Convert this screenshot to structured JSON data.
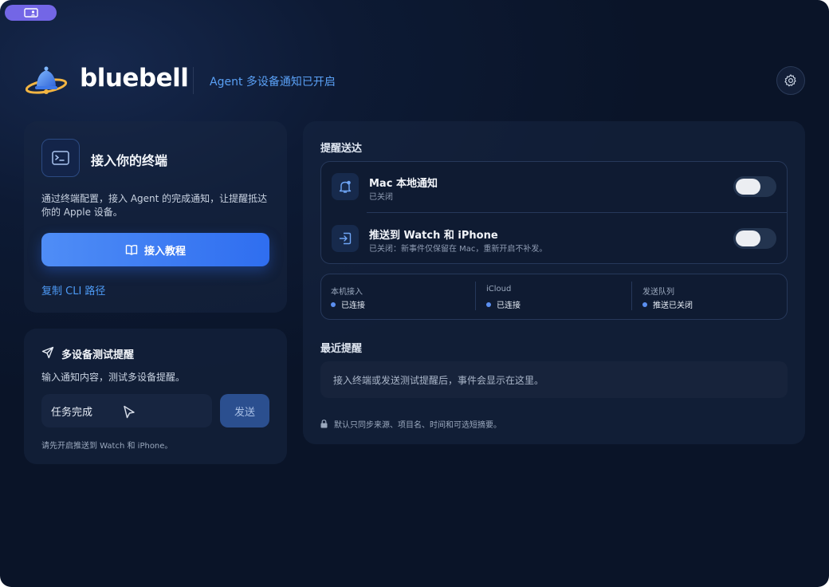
{
  "app": {
    "name": "bluebell",
    "status": "Agent 多设备通知已开启"
  },
  "terminal_card": {
    "title": "接入你的终端",
    "description": "通过终端配置，接入 Agent 的完成通知，让提醒抵达你的 Apple 设备。",
    "tutorial_button": "接入教程",
    "copy_cli": "复制 CLI 路径"
  },
  "test_card": {
    "title": "多设备测试提醒",
    "description": "输入通知内容，测试多设备提醒。",
    "input_value": "任务完成",
    "send_button": "发送",
    "hint": "请先开启推送到 Watch 和 iPhone。"
  },
  "delivery": {
    "section_title": "提醒送达",
    "rows": [
      {
        "title": "Mac 本地通知",
        "subtitle": "已关闭",
        "enabled": false
      },
      {
        "title": "推送到 Watch 和 iPhone",
        "subtitle": "已关闭：新事件仅保留在 Mac，重新开启不补发。",
        "enabled": false
      }
    ],
    "status": [
      {
        "label": "本机接入",
        "value": "已连接"
      },
      {
        "label": "iCloud",
        "value": "已连接"
      },
      {
        "label": "发送队列",
        "value": "推送已关闭"
      }
    ]
  },
  "recent": {
    "section_title": "最近提醒",
    "empty_text": "接入终端或发送测试提醒后，事件会显示在这里。",
    "privacy_note": "默认只同步来源、项目名、时间和可选短摘要。"
  },
  "icons": {
    "badge": "screen-user-icon",
    "logo": "bell-planet-logo",
    "settings": "gear-icon",
    "terminal": "terminal-icon",
    "tutorial": "book-icon",
    "test": "paper-plane-icon",
    "mac_notify": "bell-icon",
    "push": "login-arrow-icon",
    "privacy": "lock-icon"
  },
  "colors": {
    "accent": "#4d9af5",
    "button": "#2f6ef0",
    "badge": "#7366e6",
    "status_dot": "#5b8ff0"
  }
}
